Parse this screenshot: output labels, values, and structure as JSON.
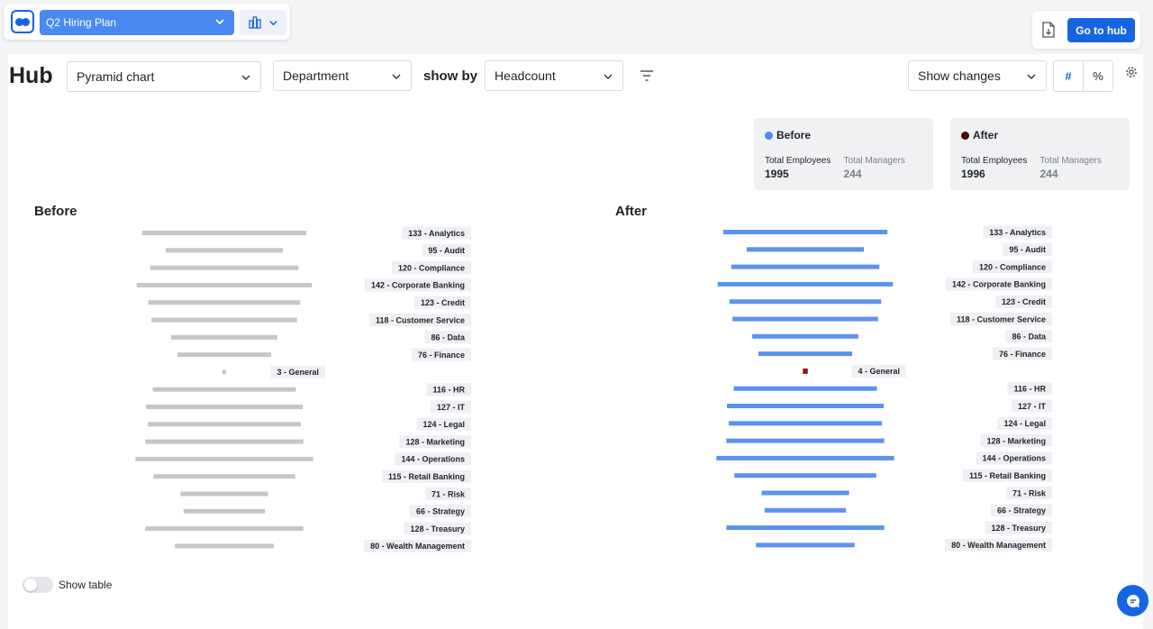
{
  "toolbar": {
    "plan_name": "Q2 Hiring Plan",
    "go_to_hub_label": "Go to hub"
  },
  "header": {
    "title": "Hub",
    "chart_type": "Pyramid chart",
    "group_by": "Department",
    "show_by_label": "show by",
    "measure": "Headcount",
    "changes_mode": "Show changes",
    "number_toggle": "#",
    "percent_toggle": "%"
  },
  "summary": {
    "before": {
      "title": "Before",
      "total_employees_label": "Total Employees",
      "total_employees": "1995",
      "total_managers_label": "Total Managers",
      "total_managers": "244",
      "color": "#4a8af0"
    },
    "after": {
      "title": "After",
      "total_employees_label": "Total Employees",
      "total_employees": "1996",
      "total_managers_label": "Total Managers",
      "total_managers": "244",
      "color": "#4a0a0a"
    }
  },
  "footer": {
    "show_table_label": "Show table",
    "show_table_on": false
  },
  "chart_data": [
    {
      "type": "bar",
      "title": "Before",
      "orientation": "horizontal",
      "color": "#c3c6cb",
      "categories": [
        "Analytics",
        "Audit",
        "Compliance",
        "Corporate Banking",
        "Credit",
        "Customer Service",
        "Data",
        "Finance",
        "General",
        "HR",
        "IT",
        "Legal",
        "Marketing",
        "Operations",
        "Retail Banking",
        "Risk",
        "Strategy",
        "Treasury",
        "Wealth Management"
      ],
      "values": [
        133,
        95,
        120,
        142,
        123,
        118,
        86,
        76,
        3,
        116,
        127,
        124,
        128,
        144,
        115,
        71,
        66,
        128,
        80
      ]
    },
    {
      "type": "bar",
      "title": "After",
      "orientation": "horizontal",
      "color": "#5b93ee",
      "highlight_color": "#8b1a1a",
      "categories": [
        "Analytics",
        "Audit",
        "Compliance",
        "Corporate Banking",
        "Credit",
        "Customer Service",
        "Data",
        "Finance",
        "General",
        "HR",
        "IT",
        "Legal",
        "Marketing",
        "Operations",
        "Retail Banking",
        "Risk",
        "Strategy",
        "Treasury",
        "Wealth Management"
      ],
      "values": [
        133,
        95,
        120,
        142,
        123,
        118,
        86,
        76,
        4,
        116,
        127,
        124,
        128,
        144,
        115,
        71,
        66,
        128,
        80
      ],
      "changed_categories": [
        "General"
      ]
    }
  ]
}
